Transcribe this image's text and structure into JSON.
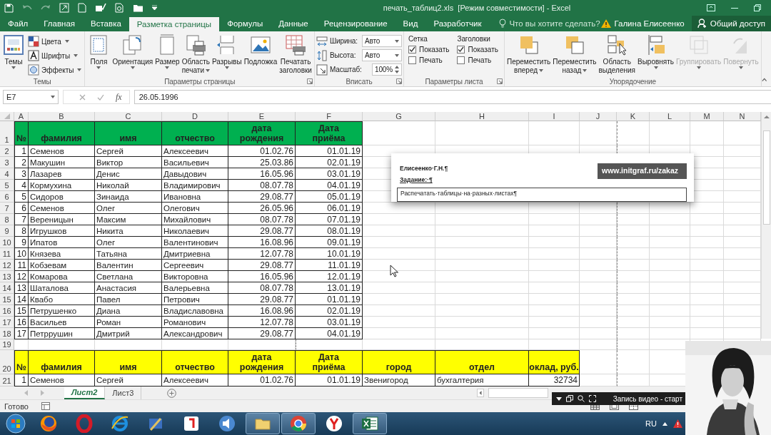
{
  "title_bar": {
    "title": "печать_таблиц2.xls  [Режим совместимости] - Excel"
  },
  "ribbon_tabs": [
    {
      "label": "Файл",
      "selected": false
    },
    {
      "label": "Главная",
      "selected": false
    },
    {
      "label": "Вставка",
      "selected": false
    },
    {
      "label": "Разметка страницы",
      "selected": true
    },
    {
      "label": "Формулы",
      "selected": false
    },
    {
      "label": "Данные",
      "selected": false
    },
    {
      "label": "Рецензирование",
      "selected": false
    },
    {
      "label": "Вид",
      "selected": false
    },
    {
      "label": "Разработчик",
      "selected": false
    }
  ],
  "tell_me": {
    "placeholder": "Что вы хотите сделать?"
  },
  "account": {
    "user": "Галина Елисеенко",
    "share": "Общий доступ"
  },
  "ribbon_groups": [
    {
      "title": "Темы",
      "launcher": false,
      "items": [
        {
          "kind": "large",
          "label": "Темы",
          "dropdown": true,
          "disabled": false
        },
        {
          "kind": "stack",
          "items": [
            {
              "label": "Цвета"
            },
            {
              "label": "Шрифты"
            },
            {
              "label": "Эффекты"
            }
          ]
        }
      ]
    },
    {
      "title": "Параметры страницы",
      "launcher": true,
      "items": [
        {
          "kind": "large",
          "label": "Поля",
          "dropdown": true,
          "disabled": false
        },
        {
          "kind": "large",
          "label": "Ориентация",
          "dropdown": true,
          "disabled": false
        },
        {
          "kind": "large",
          "label": "Размер",
          "dropdown": true,
          "disabled": false
        },
        {
          "kind": "large",
          "label": "Область\nпечати",
          "dropdown": true,
          "disabled": false
        },
        {
          "kind": "large",
          "label": "Разрывы",
          "dropdown": true,
          "disabled": false
        },
        {
          "kind": "large",
          "label": "Подложка",
          "dropdown": false,
          "disabled": false
        },
        {
          "kind": "large",
          "label": "Печатать\nзаголовки",
          "dropdown": false,
          "disabled": false
        }
      ]
    },
    {
      "title": "Вписать",
      "launcher": true,
      "items": [
        {
          "kind": "fields",
          "rows": [
            {
              "label": "Ширина:",
              "value": "Авто",
              "kind": "dropdown"
            },
            {
              "label": "Высота:",
              "value": "Авто",
              "kind": "dropdown"
            },
            {
              "label": "Масштаб:",
              "value": "100%",
              "kind": "spinner"
            }
          ]
        }
      ]
    },
    {
      "title": "Параметры листа",
      "launcher": true,
      "items": [
        {
          "kind": "checks",
          "title": "Сетка",
          "items": [
            {
              "label": "Показать",
              "checked": true
            },
            {
              "label": "Печать",
              "checked": false
            }
          ]
        },
        {
          "kind": "checks",
          "title": "Заголовки",
          "items": [
            {
              "label": "Показать",
              "checked": true
            },
            {
              "label": "Печать",
              "checked": false
            }
          ]
        }
      ]
    },
    {
      "title": "Упорядочение",
      "launcher": false,
      "items": [
        {
          "kind": "large",
          "label": "Переместить\nвперед",
          "dropdown": true,
          "disabled": false
        },
        {
          "kind": "large",
          "label": "Переместить\nназад",
          "dropdown": true,
          "disabled": false
        },
        {
          "kind": "large",
          "label": "Область\nвыделения",
          "dropdown": false,
          "disabled": false
        },
        {
          "kind": "large",
          "label": "Выровнять",
          "dropdown": true,
          "disabled": false
        },
        {
          "kind": "large",
          "label": "Группировать",
          "dropdown": true,
          "disabled": true
        },
        {
          "kind": "large",
          "label": "Повернуть",
          "dropdown": true,
          "disabled": true
        }
      ]
    }
  ],
  "formula_bar": {
    "name_box": "E7",
    "fx": "fx",
    "value": "26.05.1996"
  },
  "sheet": {
    "column_letters": [
      "A",
      "B",
      "C",
      "D",
      "E",
      "F",
      "G",
      "H",
      "I",
      "J",
      "K",
      "L",
      "M",
      "N"
    ],
    "row_numbers": [
      "1",
      "2",
      "3",
      "4",
      "5",
      "6",
      "7",
      "8",
      "9",
      "10",
      "11",
      "12",
      "13",
      "14",
      "15",
      "16",
      "17",
      "18",
      "19",
      "20",
      "21"
    ],
    "tables": [
      {
        "color": "#00b050",
        "columns": [
          {
            "label": "№",
            "kind": "number"
          },
          {
            "label": "фамилия",
            "kind": "text"
          },
          {
            "label": "имя",
            "kind": "text"
          },
          {
            "label": "отчество",
            "kind": "text"
          },
          {
            "label": "дата\nрождения",
            "kind": "number"
          },
          {
            "label": "Дата\nприёма",
            "kind": "number"
          }
        ],
        "rows": [
          [
            "1",
            "Семенов",
            "Сергей",
            "Алексеевич",
            "01.02.76",
            "01.01.19"
          ],
          [
            "2",
            "Макушин",
            "Виктор",
            "Васильевич",
            "25.03.86",
            "02.01.19"
          ],
          [
            "3",
            "Лазарев",
            "Денис",
            "Давыдович",
            "16.05.96",
            "03.01.19"
          ],
          [
            "4",
            "Кормухина",
            "Николай",
            "Владимирович",
            "08.07.78",
            "04.01.19"
          ],
          [
            "5",
            "Сидоров",
            "Зинаида",
            "Ивановна",
            "29.08.77",
            "05.01.19"
          ],
          [
            "6",
            "Семенов",
            "Олег",
            "Олегович",
            "26.05.96",
            "06.01.19"
          ],
          [
            "7",
            "Вереницын",
            "Максим",
            "Михайлович",
            "08.07.78",
            "07.01.19"
          ],
          [
            "8",
            "Игрушков",
            "Никита",
            "Николаевич",
            "29.08.77",
            "08.01.19"
          ],
          [
            "9",
            "Ипатов",
            "Олег",
            "Валентинович",
            "16.08.96",
            "09.01.19"
          ],
          [
            "10",
            "Князева",
            "Татьяна",
            "Дмитриевна",
            "12.07.78",
            "10.01.19"
          ],
          [
            "11",
            "Кобзевам",
            "Валентин",
            "Сергеевич",
            "29.08.77",
            "11.01.19"
          ],
          [
            "12",
            "Комарова",
            "Светлана",
            "Викторовна",
            "16.05.96",
            "12.01.19"
          ],
          [
            "13",
            "Шаталова",
            "Анастасия",
            "Валерьевна",
            "08.07.78",
            "13.01.19"
          ],
          [
            "14",
            "Квабо",
            "Павел",
            "Петрович",
            "29.08.77",
            "01.01.19"
          ],
          [
            "15",
            "Петрушенко",
            "Диана",
            "Владиславовна",
            "16.08.96",
            "02.01.19"
          ],
          [
            "16",
            "Васильев",
            "Роман",
            "Романович",
            "12.07.78",
            "03.01.19"
          ],
          [
            "17",
            "Петррушин",
            "Дмитрий",
            "Александрович",
            "29.08.77",
            "04.01.19"
          ]
        ]
      },
      {
        "color": "#ffff00",
        "columns": [
          {
            "label": "№",
            "kind": "number"
          },
          {
            "label": "фамилия",
            "kind": "text"
          },
          {
            "label": "имя",
            "kind": "text"
          },
          {
            "label": "отчество",
            "kind": "text"
          },
          {
            "label": "дата\nрождения",
            "kind": "number"
          },
          {
            "label": "Дата\nприёма",
            "kind": "number"
          },
          {
            "label": "город",
            "kind": "text"
          },
          {
            "label": "отдел",
            "kind": "text"
          },
          {
            "label": "оклад, руб.",
            "kind": "number"
          }
        ],
        "rows": [
          [
            "1",
            "Семенов",
            "Сергей",
            "Алексеевич",
            "01.02.76",
            "01.01.19",
            "Звенигород",
            "бухгалтерия",
            "32734"
          ]
        ]
      }
    ]
  },
  "note": {
    "author": "Елисеенко·Г.Н.¶",
    "task_label": "Задание:·¶",
    "link": "www.initgraf.ru/zakaz",
    "task": "Распечатать·таблицы·на·разных·листах¶"
  },
  "sheet_tabs": [
    {
      "label": "Лист2",
      "selected": true
    },
    {
      "label": "Лист3",
      "selected": false
    }
  ],
  "status_bar": {
    "text": "Готово"
  },
  "recorder": {
    "label": "Запись видео - старт"
  },
  "taskbar": {
    "apps": [
      {
        "open": false
      },
      {
        "open": false
      },
      {
        "open": false
      },
      {
        "open": false
      },
      {
        "open": false
      },
      {
        "open": false
      },
      {
        "open": true
      },
      {
        "open": true
      },
      {
        "open": false
      },
      {
        "open": true
      }
    ],
    "language": "RU"
  }
}
